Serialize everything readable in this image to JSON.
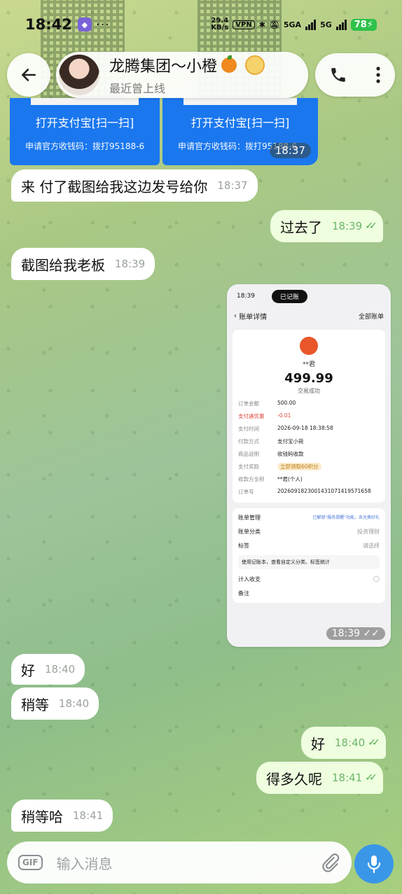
{
  "status_bar": {
    "time": "18:42",
    "speed_value": "29.4",
    "speed_unit": "KB/s",
    "vpn": "VPN",
    "net1": "5GA",
    "net2": "5G",
    "battery": "78"
  },
  "header": {
    "contact_name": "龙腾集团～小橙",
    "contact_status": "最近曾上线"
  },
  "payment_cards": [
    {
      "open_label": "打开支付宝[扫一扫]",
      "sub_label": "申请官方收钱码：拨打95188-6"
    },
    {
      "open_label": "打开支付宝[扫一扫]",
      "sub_label": "申请官方收钱码：拨打95188-6",
      "time": "18:37"
    }
  ],
  "messages": [
    {
      "dir": "in",
      "text": "来 付了截图给我这边发号给你",
      "time": "18:37"
    },
    {
      "dir": "out",
      "text": "过去了",
      "time": "18:39"
    },
    {
      "dir": "in",
      "text": "截图给我老板",
      "time": "18:39"
    },
    {
      "dir": "in",
      "text": "好",
      "time": "18:40"
    },
    {
      "dir": "in",
      "text": "稍等",
      "time": "18:40"
    },
    {
      "dir": "out",
      "text": "好",
      "time": "18:40"
    },
    {
      "dir": "out",
      "text": "得多久呢",
      "time": "18:41"
    },
    {
      "dir": "in",
      "text": "稍等哈",
      "time": "18:41"
    }
  ],
  "screenshot_message": {
    "time": "18:39",
    "status_time": "18:39",
    "island_text": "已记账",
    "nav_title": "账单详情",
    "nav_right": "全部账单",
    "payee": "**君",
    "amount": "499.99",
    "state": "交易成功",
    "rows": [
      {
        "k": "订单金额",
        "v": "500.00"
      },
      {
        "k": "支付遇优惠",
        "v": "-0.01"
      },
      {
        "k": "支付时间",
        "v": "2026-09-18 18:38:58"
      },
      {
        "k": "付款方式",
        "v": "支付宝小荷"
      },
      {
        "k": "商品说明",
        "v": "收钱码收款"
      },
      {
        "k": "支付奖励",
        "v": "立即领取60积分"
      },
      {
        "k": "收款方全称",
        "v": "**君(个人)"
      },
      {
        "k": "订单号",
        "v": "20260918230014310714195716​58"
      }
    ],
    "manage_label": "账单管理",
    "manage_promo": "已解锁\"服务提醒\"功能，去兑换好礼",
    "category_label": "账单分类",
    "category_value": "投资理财",
    "tag_label": "标签",
    "tag_value": "请选择",
    "promo_text": "使用记账本，查看自定义分类、标签统计",
    "include_label": "计入收支",
    "note_label": "备注"
  },
  "composer": {
    "gif_label": "GIF",
    "placeholder": "输入消息"
  }
}
